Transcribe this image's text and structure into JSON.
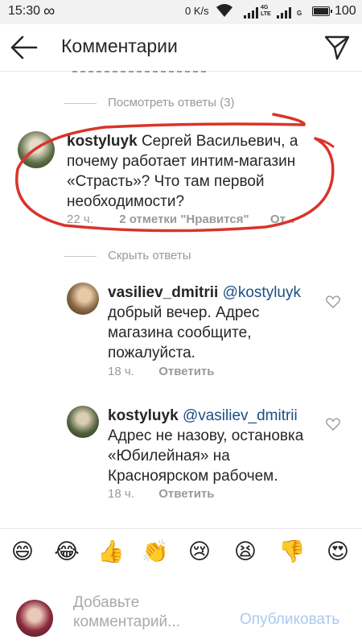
{
  "status_bar": {
    "time": "15:30",
    "network_speed": "0 K/s",
    "lte": "4G\nLTE",
    "g": "G",
    "battery_percent": "100",
    "battery_level": 1.0
  },
  "header": {
    "title": "Комментарии"
  },
  "threads": {
    "view_replies": "Посмотреть ответы (3)",
    "hide_replies": "Скрыть ответы"
  },
  "comments": [
    {
      "username": "kostyluyk",
      "text": "Сергей Васильевич, а почему работает интим-магазин «Страсть»? Что там первой необходимости?",
      "time": "22 ч.",
      "likes": "2 отметки \"Нравится\"",
      "reply": "От..."
    },
    {
      "username": "vasiliev_dmitrii",
      "mention": "@kostyluyk",
      "text": "добрый вечер. Адрес магазина сообщите, пожалуйста.",
      "time": "18 ч.",
      "reply": "Ответить"
    },
    {
      "username": "kostyluyk",
      "mention": "@vasiliev_dmitrii",
      "text": "Адрес не назову, остановка «Юбилейная» на Красноярском рабочем.",
      "time": "18 ч.",
      "reply": "Ответить"
    }
  ],
  "emoji_bar": [
    "😄",
    "😂",
    "👍",
    "👏",
    "😢",
    "😫",
    "👎",
    "😍"
  ],
  "input": {
    "placeholder": "Добавьте комментарий...",
    "post_label": "Опубликовать"
  },
  "icons": {
    "back": "arrow-left-icon",
    "send": "paper-plane-icon",
    "heart": "heart-outline-icon"
  },
  "colors": {
    "annotation": "#d9342b",
    "link": "#1a4f86",
    "post_disabled": "#a8cbef"
  }
}
